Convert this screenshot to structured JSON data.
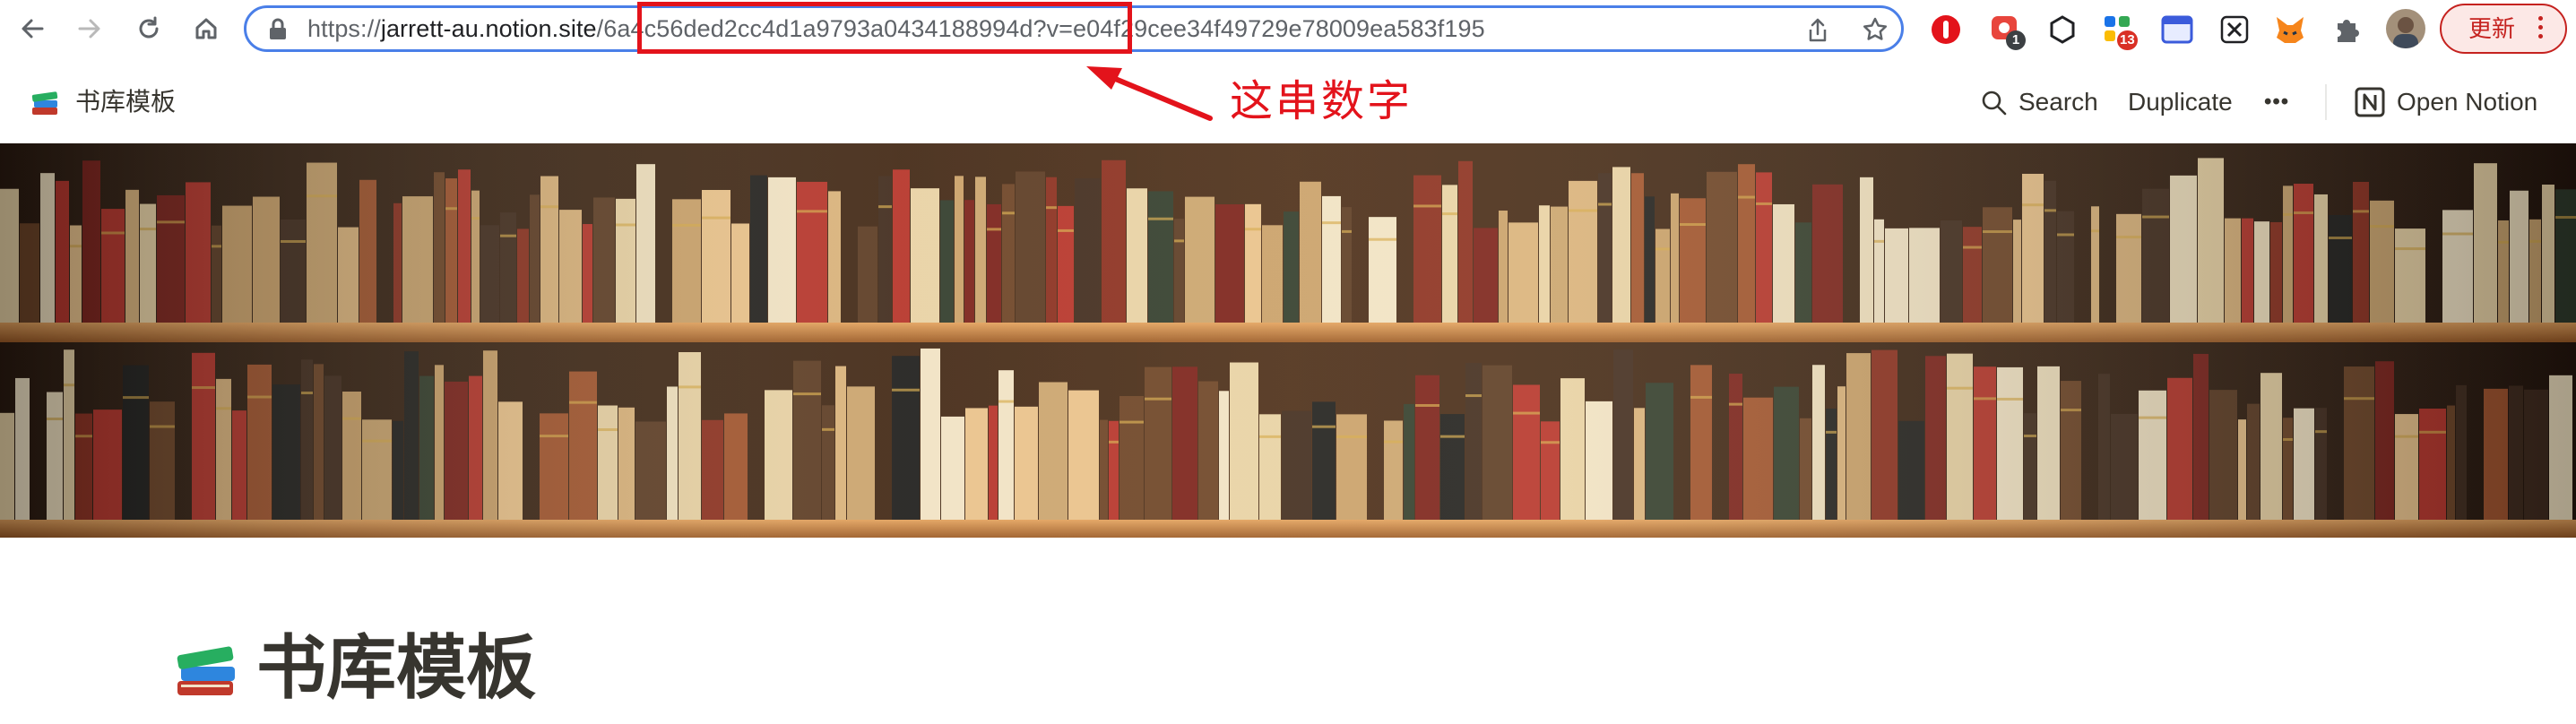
{
  "browser": {
    "url_prefix": "https://",
    "url_host": "jarrett-au.notion.site",
    "url_slash": "/",
    "url_highlight": "6a4c56ded2cc4d1a9793a0434188994d",
    "url_query": "?v=e04f29cee34f49729e78009ea583f195",
    "update_label": "更新",
    "extension_badges": [
      "1",
      "13"
    ],
    "icons": [
      "back-arrow-icon",
      "forward-arrow-icon",
      "reload-icon",
      "home-icon",
      "lock-icon",
      "share-icon",
      "star-icon",
      "extensions-icon",
      "profile-avatar"
    ]
  },
  "notion_header": {
    "page_title": "书库模板",
    "search_label": "Search",
    "duplicate_label": "Duplicate",
    "more_label": "•••",
    "open_label": "Open Notion"
  },
  "annotation": {
    "text": "这串数字",
    "color": "#e3131b"
  },
  "page": {
    "title": "书库模板",
    "icon": "books-icon"
  },
  "colors": {
    "accent_blue": "#4a7fe8",
    "highlight_red": "#e3131b",
    "update_red": "#c5221f"
  }
}
